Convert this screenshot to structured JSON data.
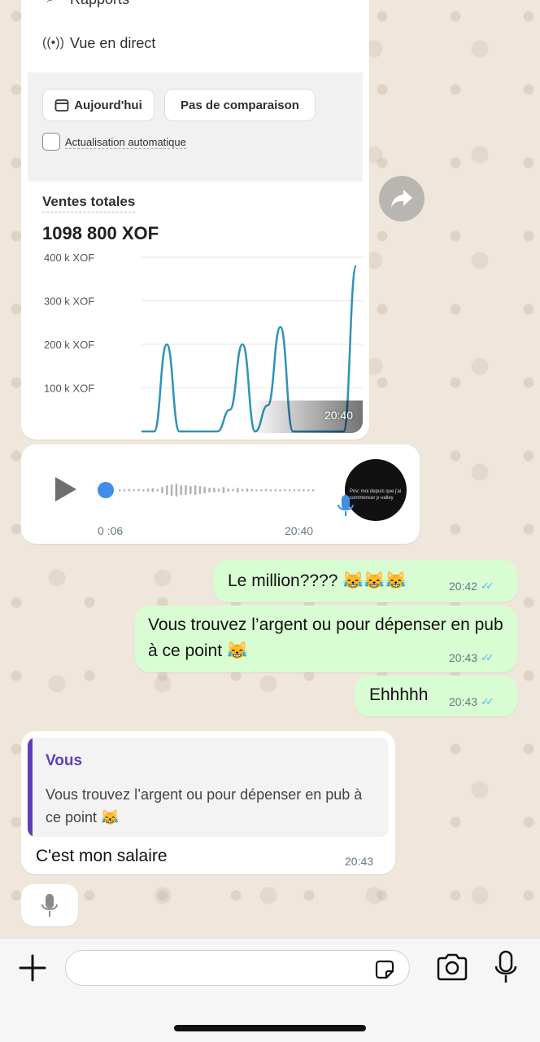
{
  "image_message": {
    "menu": [
      {
        "label": "Rapports",
        "icon": "reports-icon"
      },
      {
        "label": "Vue en direct",
        "icon": "live-icon"
      }
    ],
    "filters": {
      "today_label": "Aujourd'hui",
      "comparison_label": "Pas de comparaison",
      "auto_refresh_label": "Actualisation automatique"
    },
    "sales": {
      "title": "Ventes totales",
      "value": "1098 800 XOF"
    },
    "time": "20:40"
  },
  "chart_data": {
    "type": "line",
    "title": "Ventes totales",
    "y_ticks": [
      "400 k XOF",
      "300 k XOF",
      "200 k XOF",
      "100 k XOF"
    ],
    "ylim": [
      0,
      400000
    ],
    "series": [
      {
        "values": [
          0,
          0,
          200000,
          0,
          0,
          0,
          0,
          50000,
          200000,
          0,
          60000,
          240000,
          0,
          0,
          0,
          0,
          0,
          380000
        ]
      }
    ],
    "grid": true
  },
  "voice_message": {
    "duration": "0 :06",
    "time": "20:40",
    "avatar_caption": "Pov: moi depuis que j'ai commencer p-valley"
  },
  "outgoing": [
    {
      "text": "Le million???? 😹😹😹",
      "time": "20:42"
    },
    {
      "text": "Vous trouvez l’argent ou pour dépenser en pub à ce point 😹",
      "time": "20:43"
    },
    {
      "text": "Ehhhhh",
      "time": "20:43"
    }
  ],
  "reply_message": {
    "quoted_author": "Vous",
    "quoted_text": "Vous trouvez l’argent ou pour dépenser en pub à ce point 😹",
    "text": "C'est mon salaire",
    "time": "20:43"
  },
  "colors": {
    "outgoing_bubble": "#d9fdd3",
    "quote_accent": "#5e3fb9",
    "read_ticks": "#53bdeb",
    "chart_line": "#2f93b9"
  }
}
